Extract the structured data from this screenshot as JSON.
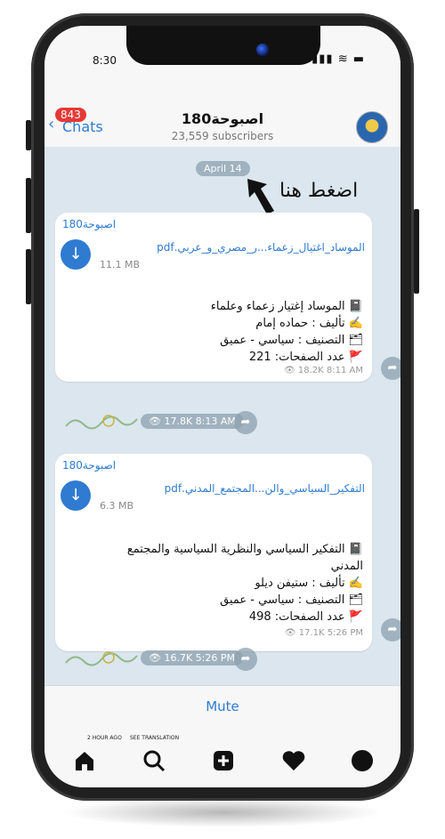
{
  "status_bar": {
    "time": "8:30",
    "signal": "▮▮▮ ≋ ▬"
  },
  "header": {
    "back_label": "Chats",
    "unread_badge": "843",
    "channel_title": "اصبوحة180",
    "subscribers": "23,559 subscribers"
  },
  "overlay": {
    "hint_text": "اضغط هنا"
  },
  "date_pill": "April 14",
  "messages": [
    {
      "sender": "اصبوحة180",
      "file_name": "الموساد_اغتيال_زعماء...ر_مصري_و_عربي.pdf",
      "file_size": "11.1 MB",
      "lines": [
        "📓 الموساد إغتيار زعماء وعلماء",
        "✍️ تأليف : حماده إمام",
        "🗂 التصنيف : سياسي - عميق",
        "🚩 عدد الصفحات: 221"
      ],
      "meta": "👁 18.2K 8:11 AM"
    },
    {
      "sender": "اصبوحة180",
      "file_name": "التفكير_السياسي_والن...المجتمع_المدني.pdf",
      "file_size": "6.3 MB",
      "lines": [
        "📓 التفكير السياسي والنظرية السياسية والمجتمع",
        "المدني",
        "✍️ تأليف : ستيفن ديلو",
        "🗂 التصنيف : سياسي - عميق",
        "🚩 عدد الصفحات: 498"
      ],
      "meta": "👁 17.1K 5:26 PM"
    }
  ],
  "sticker_metas": [
    "👁 17.8K 8:13 AM",
    "👁 16.7K 5:26 PM"
  ],
  "mute_label": "Mute",
  "nav": {
    "tiny_left": "2 HOUR AGO",
    "tiny_right": "SEE TRANSLATION"
  },
  "colors": {
    "accent": "#2f7bd1",
    "badge": "#e53935",
    "chat_bg": "#dbe6ee"
  },
  "icons": [
    "download-icon",
    "forward-icon",
    "home-icon",
    "search-icon",
    "add-icon",
    "heart-icon",
    "profile-icon"
  ]
}
